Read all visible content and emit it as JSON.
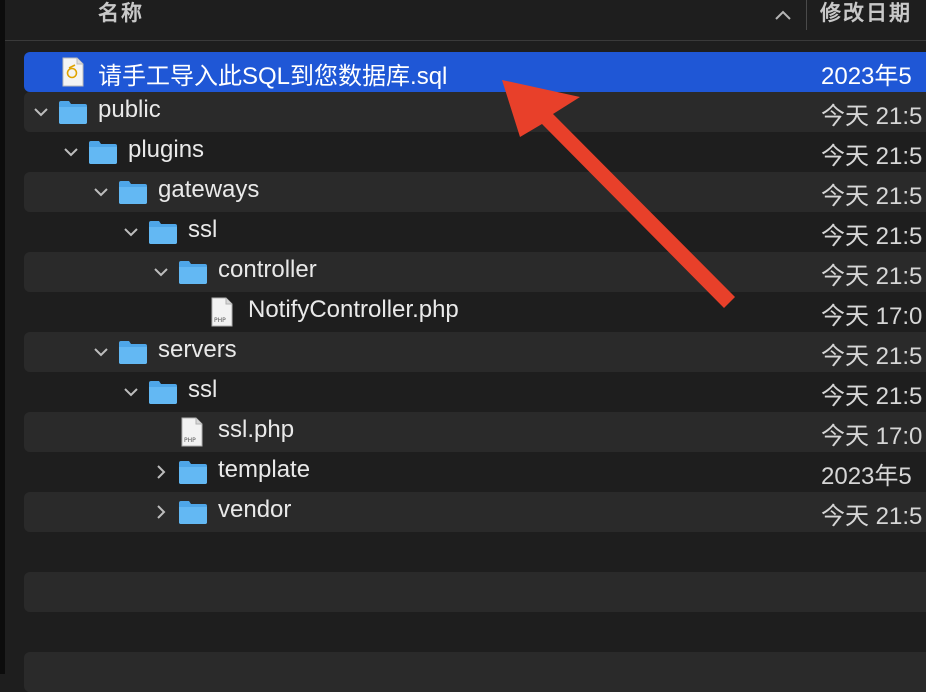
{
  "header": {
    "name_label": "名称",
    "date_label": "修改日期",
    "sort_icon": "chevron-up-icon"
  },
  "rows": [
    {
      "name": "请手工导入此SQL到您数据库.sql",
      "date": "2023年5",
      "type": "sql-file",
      "expanded": null,
      "selected": true
    },
    {
      "name": "public",
      "date": "今天 21:5",
      "type": "folder",
      "expanded": true
    },
    {
      "name": "plugins",
      "date": "今天 21:5",
      "type": "folder",
      "expanded": true
    },
    {
      "name": "gateways",
      "date": "今天 21:5",
      "type": "folder",
      "expanded": true
    },
    {
      "name": "ssl",
      "date": "今天 21:5",
      "type": "folder",
      "expanded": true
    },
    {
      "name": "controller",
      "date": "今天 21:5",
      "type": "folder",
      "expanded": true
    },
    {
      "name": "NotifyController.php",
      "date": "今天 17:0",
      "type": "php-file",
      "expanded": null
    },
    {
      "name": "servers",
      "date": "今天 21:5",
      "type": "folder",
      "expanded": true
    },
    {
      "name": "ssl",
      "date": "今天 21:5",
      "type": "folder",
      "expanded": true
    },
    {
      "name": "ssl.php",
      "date": "今天 17:0",
      "type": "php-file",
      "expanded": null
    },
    {
      "name": "template",
      "date": "2023年5",
      "type": "folder",
      "expanded": false
    },
    {
      "name": "vendor",
      "date": "今天 21:5",
      "type": "folder",
      "expanded": false
    }
  ],
  "php_icon_text": "PHP",
  "colors": {
    "selection": "#1f57d6",
    "folder": "#5ab0ee",
    "annotation_arrow": "#e8402a"
  }
}
